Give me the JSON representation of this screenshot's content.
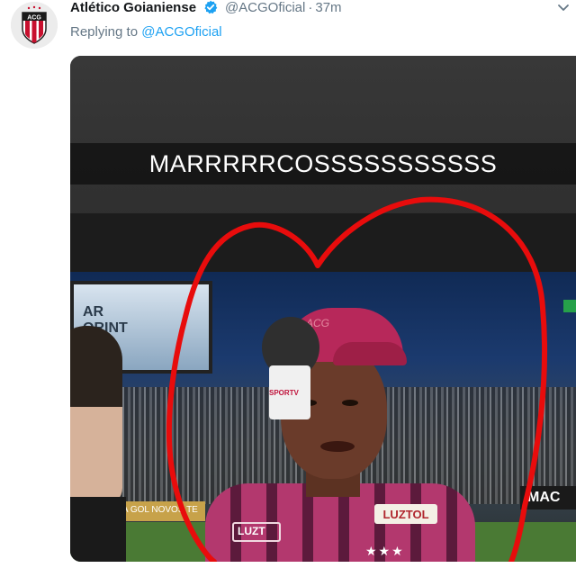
{
  "tweet": {
    "author_name": "Atlético Goianiense",
    "handle": "@ACGOficial",
    "separator": "·",
    "time": "37m",
    "replying_prefix": "Replying to",
    "replying_to": "@ACGOficial",
    "avatar_text": "ACG",
    "verified_icon": "verified-badge-icon",
    "menu_icon": "chevron-down-icon",
    "verified_color": "#1da1f2"
  },
  "media": {
    "caption": "MARRRRRCOSSSSSSSSSSS",
    "scoreboard_text": "AR\nORINT",
    "banner_left_text": "VA GOL NOVOS TE",
    "banner_right_text": "MAC",
    "cap_text": "ACG",
    "sponsor_text": "LUZTOL",
    "sponsor_small_text": "LUZT",
    "mic_label": "SPORTV",
    "annotation_color": "#e80c0c",
    "annotation_shape": "hand-drawn-heart"
  }
}
